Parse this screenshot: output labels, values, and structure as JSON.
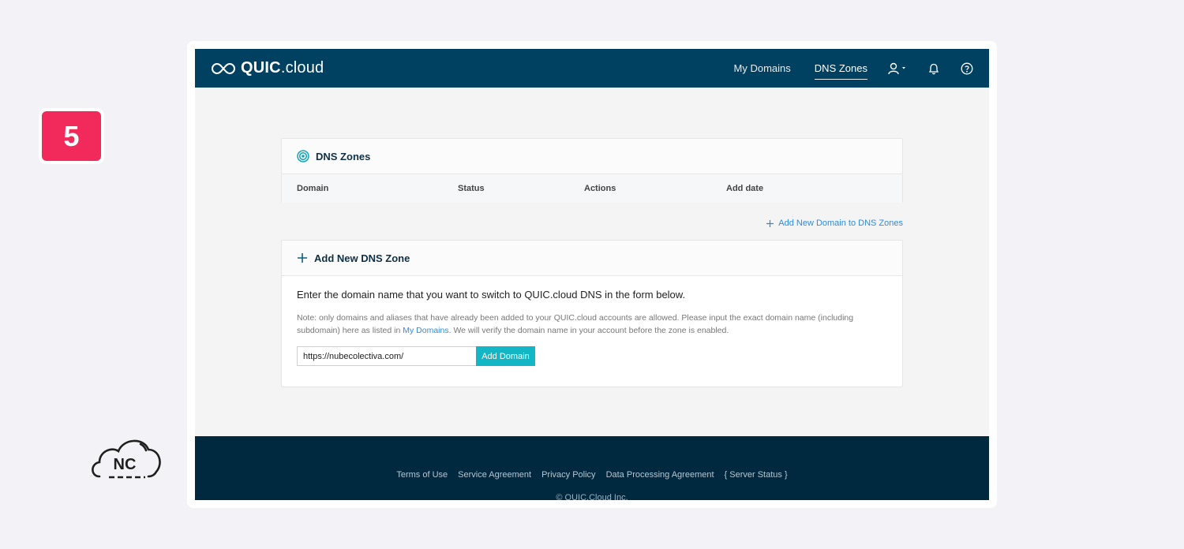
{
  "step": {
    "number": "5"
  },
  "brand": {
    "logo_text": "QUIC",
    "logo_suffix": ".cloud"
  },
  "corner_logo": {
    "text": "NC"
  },
  "nav": {
    "links": [
      {
        "label": "My Domains"
      },
      {
        "label": "DNS Zones",
        "active": true
      }
    ],
    "icons": [
      "user-icon",
      "bell-icon",
      "help-icon"
    ]
  },
  "zones_card": {
    "title": "DNS Zones",
    "columns": [
      "Domain",
      "Status",
      "Actions",
      "Add date"
    ]
  },
  "add_domain_link": {
    "label": "Add New Domain to DNS Zones"
  },
  "add_zone_card": {
    "title": "Add New DNS Zone",
    "lead": "Enter the domain name that you want to switch to QUIC.cloud DNS in the form below.",
    "note_part1": "Note: only domains and aliases that have already been added to your QUIC.cloud accounts are allowed. Please input the exact domain name (including subdomain) here as listed in ",
    "note_link": "My Domains",
    "note_part2": ". We will verify the domain name in your account before the zone is enabled.",
    "input_value": "https://nubecolectiva.com/",
    "button_label": "Add Domain"
  },
  "footer": {
    "links": [
      "Terms of Use",
      "Service Agreement",
      "Privacy Policy",
      "Data Processing Agreement",
      "{ Server Status }"
    ],
    "copyright": "© QUIC.Cloud Inc."
  },
  "colors": {
    "nav_bg": "#004060",
    "footer_bg": "#002940",
    "accent": "#13b6c4",
    "link": "#2f8bd8",
    "step_badge": "#f2295b"
  }
}
